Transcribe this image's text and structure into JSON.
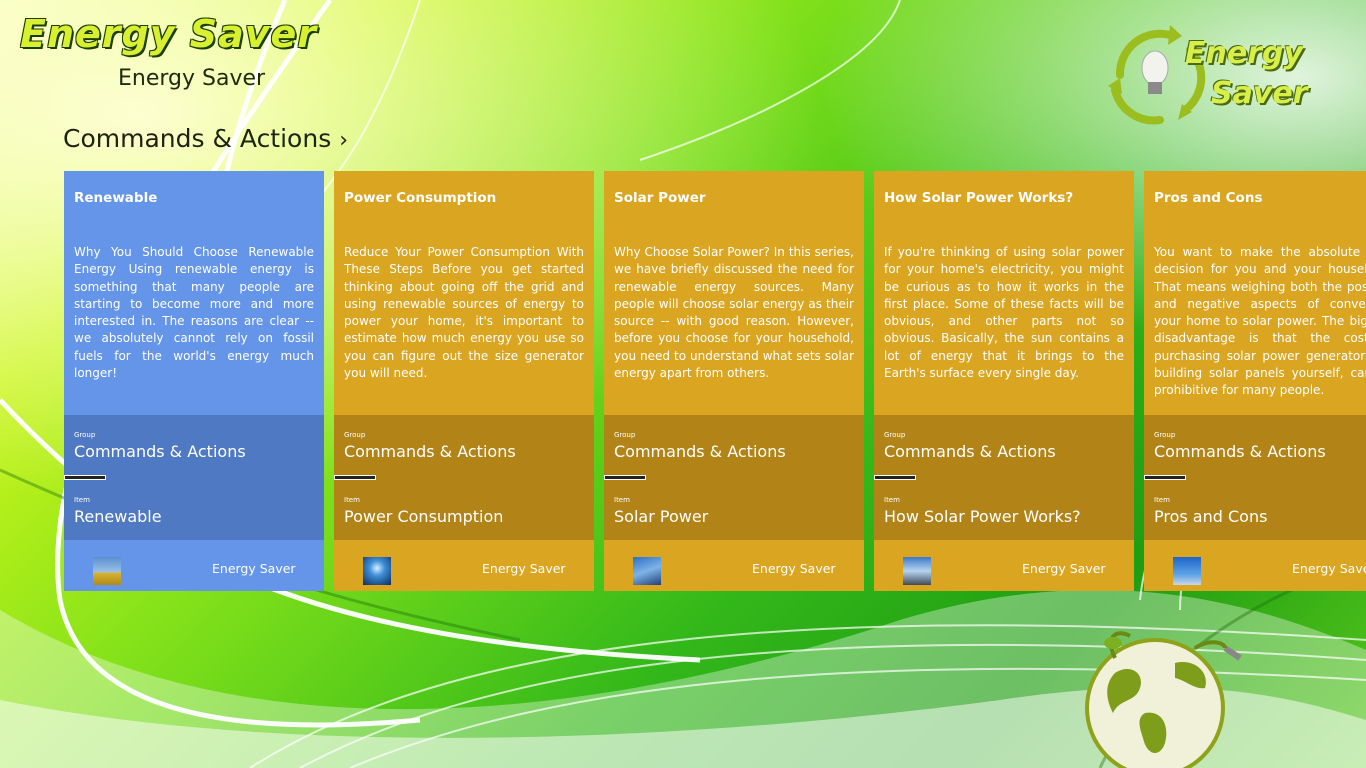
{
  "app": {
    "logo_text": "Energy Saver",
    "subtitle": "Energy Saver",
    "corner_logo_line1": "Energy",
    "corner_logo_line2": "Saver"
  },
  "section": {
    "title": "Commands & Actions",
    "chevron": "›"
  },
  "colors": {
    "blue_tile": "#6495e8",
    "blue_band": "#4f79c2",
    "gold_tile": "#daa521",
    "gold_band": "#b28417"
  },
  "tiles": [
    {
      "title": "Renewable",
      "body": "Why You Should Choose Renewable Energy Using renewable energy is something that many people are starting to become more and more interested in. The reasons are clear -- we absolutely cannot rely on fossil fuels for the world's energy much longer!",
      "group_label": "Group",
      "group_value": "Commands & Actions",
      "item_label": "Item",
      "item_value": "Renewable",
      "footer": "Energy Saver",
      "thumb_icon": "wind-turbines-thumbnail",
      "progress": 0.16,
      "selected": true
    },
    {
      "title": "Power Consumption",
      "body": "Reduce Your Power Consumption With These Steps Before you get started thinking about going off the grid and using renewable sources of energy to power your home, it's important to estimate how much energy you use so you can figure out the size generator you will need.",
      "group_label": "Group",
      "group_value": "Commands & Actions",
      "item_label": "Item",
      "item_value": "Power Consumption",
      "footer": "Energy Saver",
      "thumb_icon": "lightning-thumbnail",
      "progress": 0.16,
      "selected": false
    },
    {
      "title": "Solar Power",
      "body": "Why Choose Solar Power? In this series, we have briefly discussed the need for renewable energy sources. Many people will choose solar energy as their source -- with good reason. However, before you choose for your household, you need to understand what sets solar energy apart from others.",
      "group_label": "Group",
      "group_value": "Commands & Actions",
      "item_label": "Item",
      "item_value": "Solar Power",
      "footer": "Energy Saver",
      "thumb_icon": "solar-panel-thumbnail",
      "progress": 0.16,
      "selected": false
    },
    {
      "title": "How Solar Power Works?",
      "body": "If you're thinking of using solar power for your home's electricity, you might be curious as to how it works in the first place. Some of these facts will be obvious, and other parts not so obvious. Basically, the sun contains a lot of energy that it brings to the Earth's surface every single day.",
      "group_label": "Group",
      "group_value": "Commands & Actions",
      "item_label": "Item",
      "item_value": "How Solar Power Works?",
      "footer": "Energy Saver",
      "thumb_icon": "solar-array-thumbnail",
      "progress": 0.16,
      "selected": false
    },
    {
      "title": "Pros and Cons",
      "body": "You want to make the absolute best decision for you and your household. That means weighing both the positive and negative aspects of converting your home to solar power. The biggest disadvantage is that the cost of purchasing solar power generators, or building solar panels yourself, can be prohibitive for many people.",
      "group_label": "Group",
      "group_value": "Commands & Actions",
      "item_label": "Item",
      "item_value": "Pros and Cons",
      "footer": "Energy Saver",
      "thumb_icon": "wind-farm-thumbnail",
      "progress": 0.16,
      "selected": false
    }
  ]
}
